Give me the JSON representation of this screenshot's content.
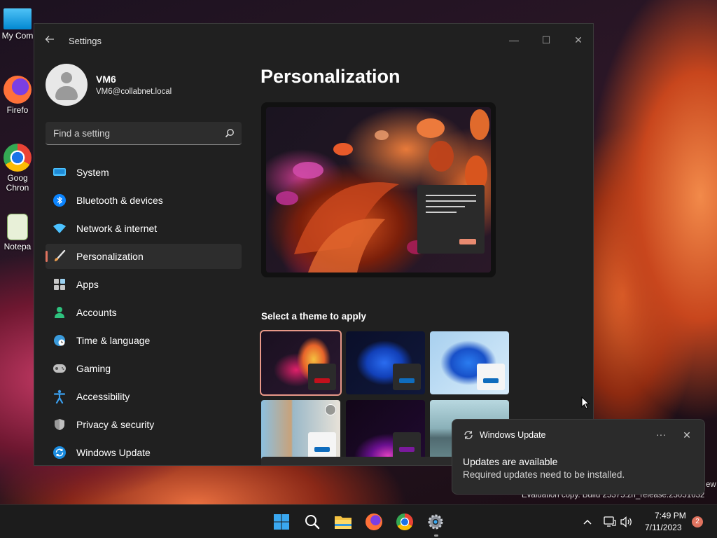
{
  "desktop": {
    "icons": [
      {
        "label": "My Com"
      },
      {
        "label": "Firefo"
      },
      {
        "label": "Goog"
      },
      {
        "label": "Chron"
      },
      {
        "label": "Notepa"
      }
    ]
  },
  "window": {
    "title": "Settings",
    "controls": {
      "minimize": "—",
      "maximize": "☐",
      "close": "✕"
    }
  },
  "account": {
    "name": "VM6",
    "email": "VM6@collabnet.local"
  },
  "search": {
    "placeholder": "Find a setting",
    "value": ""
  },
  "nav": {
    "items": [
      {
        "label": "System",
        "icon": "system-icon"
      },
      {
        "label": "Bluetooth & devices",
        "icon": "bluetooth-icon"
      },
      {
        "label": "Network & internet",
        "icon": "wifi-icon"
      },
      {
        "label": "Personalization",
        "icon": "brush-icon",
        "active": true
      },
      {
        "label": "Apps",
        "icon": "apps-icon"
      },
      {
        "label": "Accounts",
        "icon": "person-icon"
      },
      {
        "label": "Time & language",
        "icon": "globe-clock-icon"
      },
      {
        "label": "Gaming",
        "icon": "gamepad-icon"
      },
      {
        "label": "Accessibility",
        "icon": "accessibility-icon"
      },
      {
        "label": "Privacy & security",
        "icon": "shield-icon"
      },
      {
        "label": "Windows Update",
        "icon": "sync-icon"
      }
    ]
  },
  "content": {
    "title": "Personalization",
    "theme_section_label": "Select a theme to apply",
    "themes": [
      {
        "name": "glow-dark",
        "selected": true,
        "accent": "#c2101c"
      },
      {
        "name": "bloom-dark",
        "selected": false,
        "accent": "#0f6cbd"
      },
      {
        "name": "bloom-light",
        "selected": false,
        "accent": "#0f6cbd"
      },
      {
        "name": "flowers",
        "selected": false,
        "accent": "#0f6cbd"
      },
      {
        "name": "captured-motion",
        "selected": false,
        "accent": "#7a1a9c"
      },
      {
        "name": "sunrise",
        "selected": false,
        "accent": "#0f6cbd"
      }
    ]
  },
  "notification": {
    "app": "Windows Update",
    "title": "Updates are available",
    "body": "Required updates need to be installed.",
    "more": "···",
    "close": "✕"
  },
  "watermark": {
    "line2": "Evaluation copy. Build 25375.zn_release.2305",
    "line2_end": "1632",
    "line1_end": "ew"
  },
  "taskbar": {
    "time": "7:49 PM",
    "date": "7/11/2023",
    "badge": "2"
  },
  "colors": {
    "accent": "#e0735f",
    "window_bg": "#202020",
    "taskbar_bg": "#1c1c1c"
  }
}
